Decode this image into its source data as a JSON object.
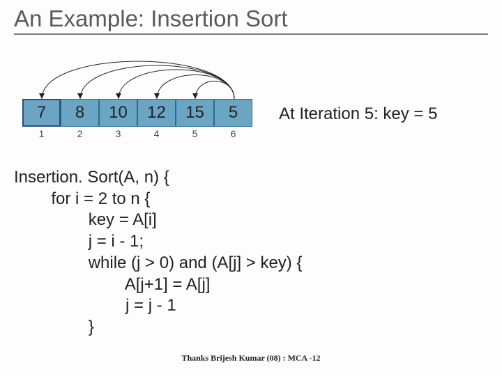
{
  "title": "An Example: Insertion Sort",
  "array": {
    "values": [
      "7",
      "8",
      "10",
      "12",
      "15",
      "5"
    ],
    "indices": [
      "1",
      "2",
      "3",
      "4",
      "5",
      "6"
    ]
  },
  "iteration_label": "At Iteration 5: key = 5",
  "code": {
    "l1": "Insertion. Sort(A, n) {",
    "l2": "        for i = 2 to n {",
    "l3": "                key = A[i]",
    "l4": "                j = i - 1;",
    "l5": "                while (j > 0) and (A[j] > key) {",
    "l6": "                        A[j+1] = A[j]",
    "l7": "                        j = j - 1",
    "l8": "                }"
  },
  "credit": "Thanks Brijesh Kumar (08) : MCA -12",
  "chart_data": {
    "type": "table",
    "title": "Insertion Sort array state at iteration 5",
    "categories": [
      "1",
      "2",
      "3",
      "4",
      "5",
      "6"
    ],
    "values": [
      7,
      8,
      10,
      12,
      15,
      5
    ],
    "sorted_prefix_end_index": 5,
    "key_index": 6,
    "key_value": 5,
    "arcs_from_index": 6,
    "arcs_to_indices": [
      1,
      2,
      3,
      4,
      5
    ]
  }
}
